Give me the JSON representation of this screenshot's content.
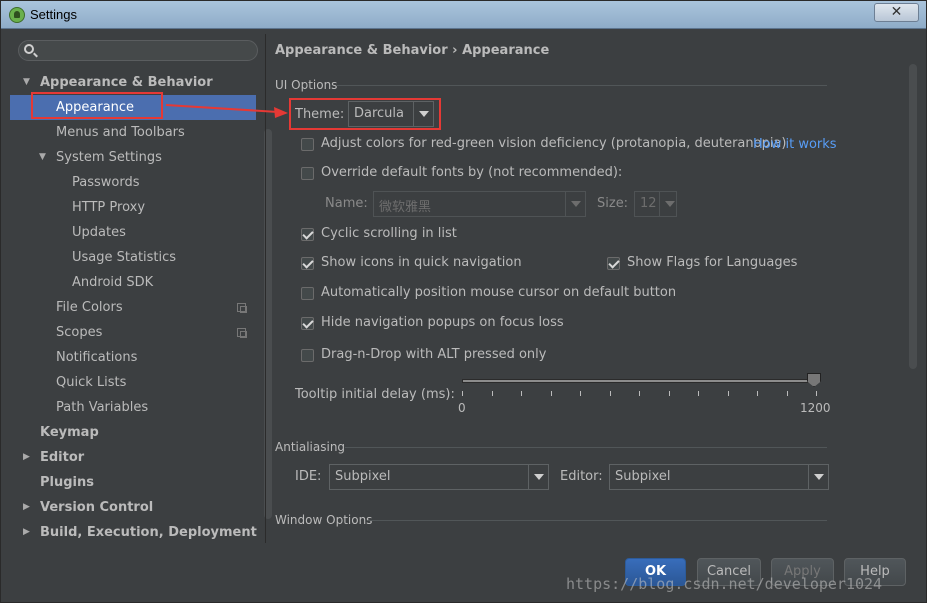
{
  "window": {
    "title": "Settings",
    "close_symbol": "✕"
  },
  "search": {
    "value": "",
    "placeholder": ""
  },
  "tree": [
    {
      "label": "Appearance & Behavior",
      "level": 0,
      "bold": true,
      "arrow": "▼"
    },
    {
      "label": "Appearance",
      "level": 1,
      "selected": true
    },
    {
      "label": "Menus and Toolbars",
      "level": 1
    },
    {
      "label": "System Settings",
      "level": 1,
      "arrow": "▼"
    },
    {
      "label": "Passwords",
      "level": 2
    },
    {
      "label": "HTTP Proxy",
      "level": 2
    },
    {
      "label": "Updates",
      "level": 2
    },
    {
      "label": "Usage Statistics",
      "level": 2
    },
    {
      "label": "Android SDK",
      "level": 2
    },
    {
      "label": "File Colors",
      "level": 1,
      "copy": true
    },
    {
      "label": "Scopes",
      "level": 1,
      "copy": true
    },
    {
      "label": "Notifications",
      "level": 1
    },
    {
      "label": "Quick Lists",
      "level": 1
    },
    {
      "label": "Path Variables",
      "level": 1
    },
    {
      "label": "Keymap",
      "level": 0,
      "bold": true
    },
    {
      "label": "Editor",
      "level": 0,
      "bold": true,
      "arrow": "▶"
    },
    {
      "label": "Plugins",
      "level": 0,
      "bold": true
    },
    {
      "label": "Version Control",
      "level": 0,
      "bold": true,
      "arrow": "▶"
    },
    {
      "label": "Build, Execution, Deployment",
      "level": 0,
      "bold": true,
      "arrow": "▶"
    }
  ],
  "breadcrumb": {
    "parent": "Appearance & Behavior",
    "separator": "›",
    "current": "Appearance"
  },
  "ui_options": {
    "section_title": "UI Options",
    "theme_label": "Theme:",
    "theme_value": "Darcula",
    "adjust_colors": {
      "label": "Adjust colors for red-green vision deficiency (protanopia, deuteranopia)",
      "checked": false
    },
    "how_it_works": "How it works",
    "override_fonts": {
      "label": "Override default fonts by (not recommended):",
      "checked": false
    },
    "name_label": "Name:",
    "name_value": "微软雅黑",
    "size_label": "Size:",
    "size_value": "12",
    "cyclic_scrolling": {
      "label": "Cyclic scrolling in list",
      "checked": true
    },
    "show_icons": {
      "label": "Show icons in quick navigation",
      "checked": true
    },
    "show_flags": {
      "label": "Show Flags for Languages",
      "checked": true
    },
    "auto_position": {
      "label": "Automatically position mouse cursor on default button",
      "checked": false
    },
    "hide_navigation": {
      "label": "Hide navigation popups on focus loss",
      "checked": true
    },
    "drag_n_drop": {
      "label": "Drag-n-Drop with ALT pressed only",
      "checked": false
    },
    "tooltip_label": "Tooltip initial delay (ms):",
    "tooltip_min": "0",
    "tooltip_max": "1200",
    "tooltip_value": 1200
  },
  "antialiasing": {
    "section_title": "Antialiasing",
    "ide_label": "IDE:",
    "ide_value": "Subpixel",
    "editor_label": "Editor:",
    "editor_value": "Subpixel"
  },
  "window_options": {
    "section_title": "Window Options"
  },
  "buttons": {
    "ok": "OK",
    "cancel": "Cancel",
    "apply": "Apply",
    "help": "Help"
  },
  "watermark": "https://blog.csdn.net/developer1024",
  "colors": {
    "highlight": "#e53935",
    "selection": "#4b6eaf",
    "link": "#589df6"
  }
}
